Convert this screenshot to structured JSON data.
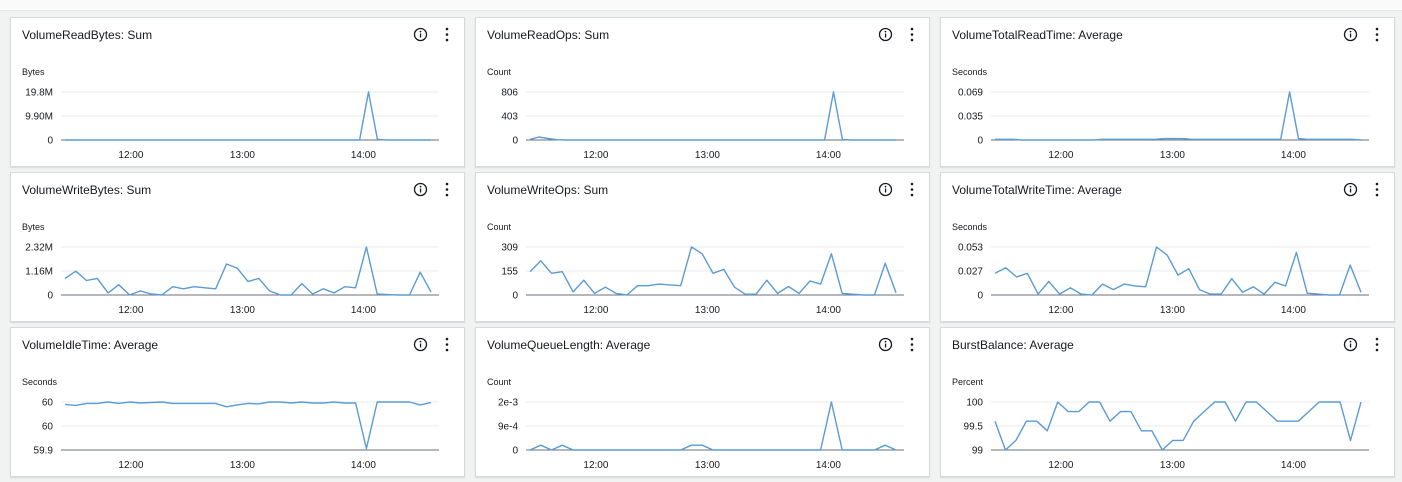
{
  "colors": {
    "line": "#5a9bd5",
    "grid": "#e9ebed",
    "axis": "#687078"
  },
  "icons": {
    "info": "info-circle-icon",
    "more": "vertical-ellipsis-icon"
  },
  "chart_data": [
    {
      "type": "line",
      "title": "VolumeReadBytes: Sum",
      "ylabel": "Bytes",
      "yticks": [
        "0",
        "9.90M",
        "19.8M"
      ],
      "xticks": [
        "12:00",
        "13:00",
        "14:00"
      ],
      "values": [
        0,
        0,
        0,
        0,
        0,
        0,
        0,
        0,
        0,
        0,
        0,
        0,
        0,
        0,
        0,
        0,
        0,
        0,
        0,
        0,
        0,
        0,
        0,
        0,
        0,
        0,
        0,
        0,
        0,
        0,
        0,
        0,
        0,
        0,
        19.8,
        0.3,
        0,
        0,
        0,
        0,
        0,
        0
      ]
    },
    {
      "type": "line",
      "title": "VolumeReadOps: Sum",
      "ylabel": "Count",
      "yticks": [
        "0",
        "403",
        "806"
      ],
      "xticks": [
        "12:00",
        "13:00",
        "14:00"
      ],
      "values": [
        10,
        50,
        25,
        5,
        0,
        0,
        0,
        0,
        0,
        0,
        0,
        0,
        0,
        0,
        0,
        0,
        0,
        0,
        0,
        0,
        0,
        0,
        0,
        0,
        0,
        0,
        0,
        0,
        0,
        0,
        0,
        0,
        0,
        0,
        806,
        10,
        0,
        0,
        0,
        0,
        0,
        0
      ]
    },
    {
      "type": "line",
      "title": "VolumeTotalReadTime: Average",
      "ylabel": "Seconds",
      "yticks": [
        "0",
        "0.035",
        "0.069"
      ],
      "xticks": [
        "12:00",
        "13:00",
        "14:00"
      ],
      "values": [
        0.001,
        0.001,
        0.001,
        0,
        0,
        0,
        0,
        0,
        0,
        0,
        0,
        0,
        0.001,
        0.001,
        0.001,
        0.001,
        0.001,
        0.001,
        0.001,
        0.002,
        0.002,
        0.002,
        0.001,
        0.001,
        0.001,
        0.001,
        0.001,
        0.001,
        0.001,
        0.001,
        0.001,
        0.001,
        0.001,
        0.069,
        0.002,
        0.001,
        0.001,
        0.001,
        0.001,
        0.001,
        0.001,
        0
      ]
    },
    {
      "type": "line",
      "title": "VolumeWriteBytes: Sum",
      "ylabel": "Bytes",
      "yticks": [
        "0",
        "1.16M",
        "2.32M"
      ],
      "xticks": [
        "12:00",
        "13:00",
        "14:00"
      ],
      "values": [
        0.8,
        1.15,
        0.7,
        0.8,
        0.1,
        0.5,
        0,
        0.2,
        0.05,
        0,
        0.4,
        0.3,
        0.4,
        0.35,
        0.3,
        1.5,
        1.3,
        0.65,
        0.8,
        0.2,
        0,
        0,
        0.55,
        0.05,
        0.3,
        0.1,
        0.4,
        0.35,
        2.32,
        0.05,
        0.02,
        0,
        0,
        1.1,
        0.15
      ]
    },
    {
      "type": "line",
      "title": "VolumeWriteOps: Sum",
      "ylabel": "Count",
      "yticks": [
        "0",
        "155",
        "309"
      ],
      "xticks": [
        "12:00",
        "13:00",
        "14:00"
      ],
      "values": [
        150,
        220,
        140,
        150,
        20,
        95,
        10,
        50,
        10,
        0,
        60,
        60,
        70,
        65,
        60,
        309,
        265,
        140,
        165,
        50,
        5,
        5,
        95,
        10,
        55,
        10,
        90,
        70,
        265,
        10,
        5,
        0,
        0,
        205,
        15
      ]
    },
    {
      "type": "line",
      "title": "VolumeTotalWriteTime: Average",
      "ylabel": "Seconds",
      "yticks": [
        "0",
        "0.027",
        "0.053"
      ],
      "xticks": [
        "12:00",
        "13:00",
        "14:00"
      ],
      "values": [
        0.024,
        0.03,
        0.02,
        0.024,
        0.001,
        0.015,
        0.001,
        0.008,
        0.001,
        0,
        0.012,
        0.006,
        0.012,
        0.01,
        0.009,
        0.053,
        0.044,
        0.022,
        0.029,
        0.006,
        0.001,
        0.001,
        0.018,
        0.003,
        0.009,
        0.001,
        0.014,
        0.01,
        0.047,
        0.002,
        0.001,
        0,
        0,
        0.033,
        0.003
      ]
    },
    {
      "type": "line",
      "title": "VolumeIdleTime: Average",
      "ylabel": "Seconds",
      "yticks": [
        "59.9",
        "60",
        "60"
      ],
      "xticks": [
        "12:00",
        "13:00",
        "14:00"
      ],
      "values": [
        59.995,
        59.993,
        59.997,
        59.997,
        60.0,
        59.997,
        60.0,
        59.998,
        59.999,
        60.0,
        59.997,
        59.997,
        59.997,
        59.997,
        59.997,
        59.99,
        59.994,
        59.997,
        59.996,
        60.0,
        60.0,
        59.998,
        60.0,
        59.998,
        59.998,
        60.0,
        59.998,
        59.998,
        59.903,
        60.0,
        60.0,
        60.0,
        60.0,
        59.994,
        59.999
      ]
    },
    {
      "type": "line",
      "title": "VolumeQueueLength: Average",
      "ylabel": "Count",
      "yticks": [
        "0",
        "9e-4",
        "2e-3"
      ],
      "xticks": [
        "12:00",
        "13:00",
        "14:00"
      ],
      "values": [
        0,
        0.0002,
        0,
        0.0002,
        0,
        0,
        0,
        0,
        0,
        0,
        0,
        0,
        0,
        0,
        0,
        0.0002,
        0.0002,
        0,
        0,
        0,
        0,
        0,
        0,
        0,
        0,
        0,
        0,
        0,
        0.002,
        0,
        0,
        0,
        0,
        0.0002,
        0
      ]
    },
    {
      "type": "line",
      "title": "BurstBalance: Average",
      "ylabel": "Percent",
      "yticks": [
        "99",
        "99.5",
        "100"
      ],
      "xticks": [
        "12:00",
        "13:00",
        "14:00"
      ],
      "values": [
        99.6,
        99.0,
        99.2,
        99.6,
        99.6,
        99.4,
        100,
        99.8,
        99.8,
        100,
        100,
        99.6,
        99.8,
        99.8,
        99.4,
        99.4,
        99.0,
        99.2,
        99.2,
        99.6,
        99.8,
        100,
        100,
        99.6,
        100,
        100,
        99.8,
        99.6,
        99.6,
        99.6,
        99.8,
        100,
        100,
        100,
        99.2,
        100
      ]
    }
  ]
}
